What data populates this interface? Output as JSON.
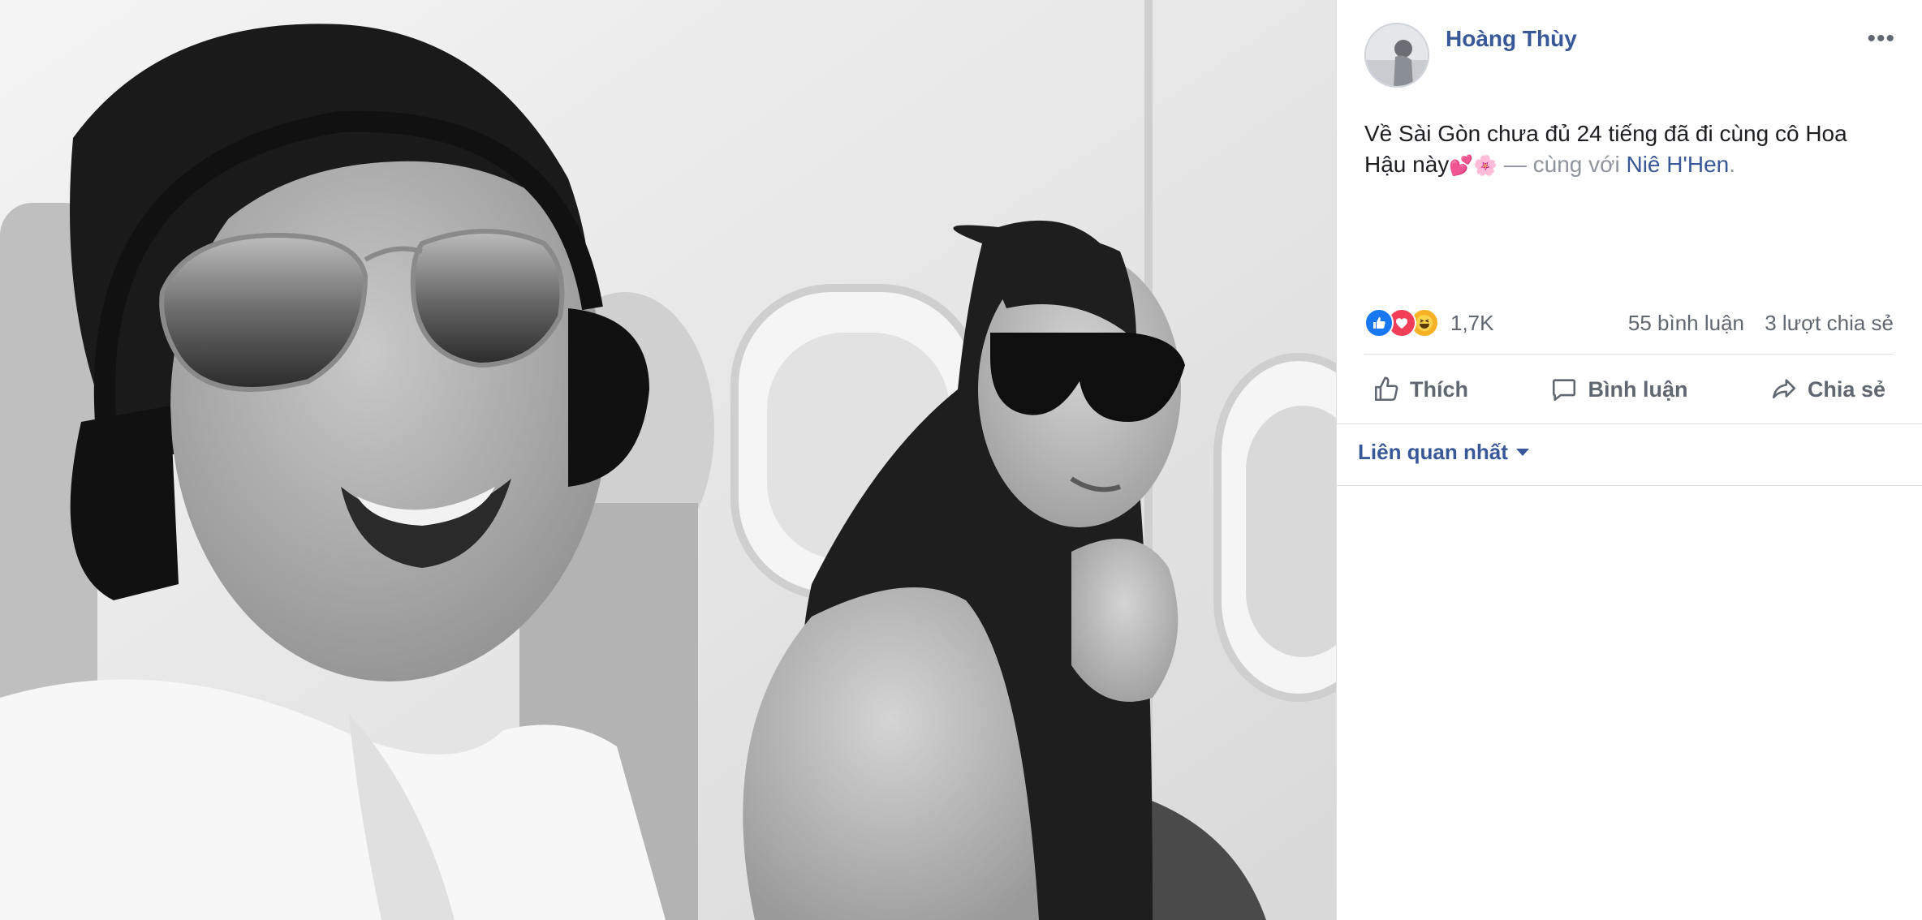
{
  "post": {
    "author": "Hoàng Thùy",
    "caption_main": "Về Sài Gòn chưa đủ 24 tiếng đã đi cùng cô Hoa Hậu này",
    "caption_emoji": "💕🌸",
    "caption_with": "— cùng với",
    "tagged_person": "Niê H'Hen",
    "caption_end": "."
  },
  "stats": {
    "reaction_count": "1,7K",
    "comments": "55 bình luận",
    "shares": "3 lượt chia sẻ",
    "reactions": [
      "like-icon",
      "love-icon",
      "haha-icon"
    ]
  },
  "actions": {
    "like_label": "Thích",
    "comment_label": "Bình luận",
    "share_label": "Chia sẻ"
  },
  "comments": {
    "sort_label": "Liên quan nhất"
  },
  "colors": {
    "link": "#385898",
    "muted": "#606770",
    "like": "#1877f2",
    "love": "#f33e58",
    "haha": "#f7b125"
  }
}
